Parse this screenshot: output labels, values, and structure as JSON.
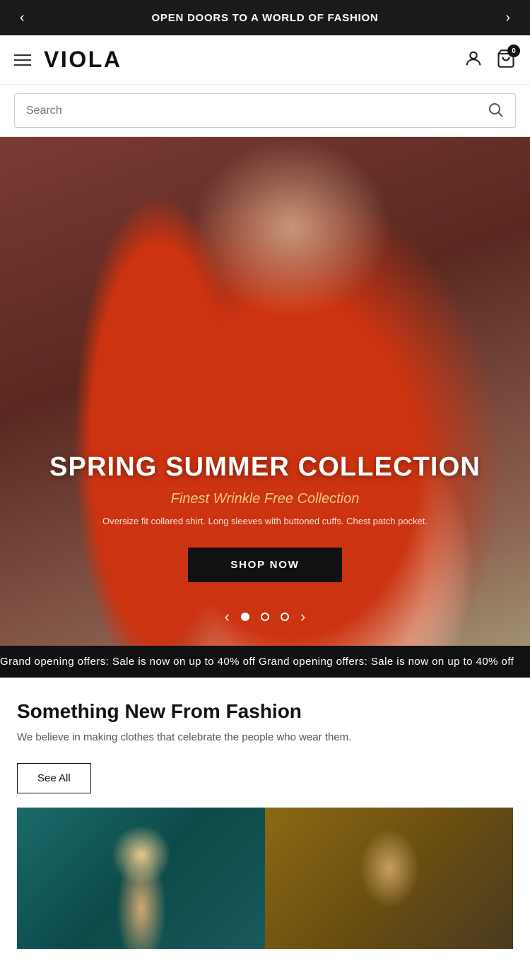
{
  "announcement": {
    "text": "OPEN DOORS TO A WORLD OF FASHION",
    "prev_label": "‹",
    "next_label": "›"
  },
  "header": {
    "logo": "VIOLA",
    "cart_count": "0"
  },
  "search": {
    "placeholder": "Search"
  },
  "hero": {
    "title": "SPRING SUMMER COLLECTION",
    "subtitle": "Finest Wrinkle Free Collection",
    "description": "Oversize fit collared shirt. Long sleeves with buttoned cuffs. Chest patch pocket.",
    "cta_label": "SHOP NOW",
    "dots": [
      {
        "active": true
      },
      {
        "active": false
      },
      {
        "active": false
      }
    ]
  },
  "promo_ticker": {
    "text": "Grand opening offers: Sale is now on up to 40% off     Grand opening offers: Sale is now on up to 40% off     "
  },
  "new_section": {
    "title": "Something New From Fashion",
    "description": "We believe in making clothes that celebrate the people who wear them.",
    "see_all_label": "See All"
  }
}
